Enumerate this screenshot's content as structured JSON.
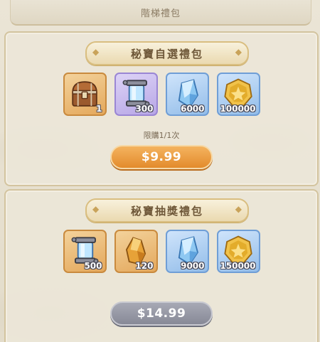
{
  "header": {
    "title": "階梯禮包"
  },
  "packs": [
    {
      "title": "秘寶自選禮包",
      "items": [
        {
          "icon": "treasure-chest-icon",
          "qty": "1",
          "color": "#e4a85c"
        },
        {
          "icon": "crystal-lantern-icon",
          "qty": "300",
          "color": "#b7a6e6"
        },
        {
          "icon": "blue-crystal-icon",
          "qty": "6000",
          "color": "#93bde9"
        },
        {
          "icon": "gold-coin-icon",
          "qty": "100000",
          "color": "#93bde9"
        }
      ],
      "limit": "限購1/1次",
      "price": "$9.99",
      "button_state": "active",
      "button_color": "#e38b2c"
    },
    {
      "title": "秘寶抽獎禮包",
      "items": [
        {
          "icon": "crystal-lantern-icon",
          "qty": "500",
          "color": "#e4a85c"
        },
        {
          "icon": "amber-shard-icon",
          "qty": "120",
          "color": "#e4a85c"
        },
        {
          "icon": "blue-crystal-icon",
          "qty": "9000",
          "color": "#93bde9"
        },
        {
          "icon": "gold-coin-icon",
          "qty": "150000",
          "color": "#93bde9"
        }
      ],
      "price": "$14.99",
      "button_state": "disabled",
      "button_color": "#878997"
    }
  ]
}
